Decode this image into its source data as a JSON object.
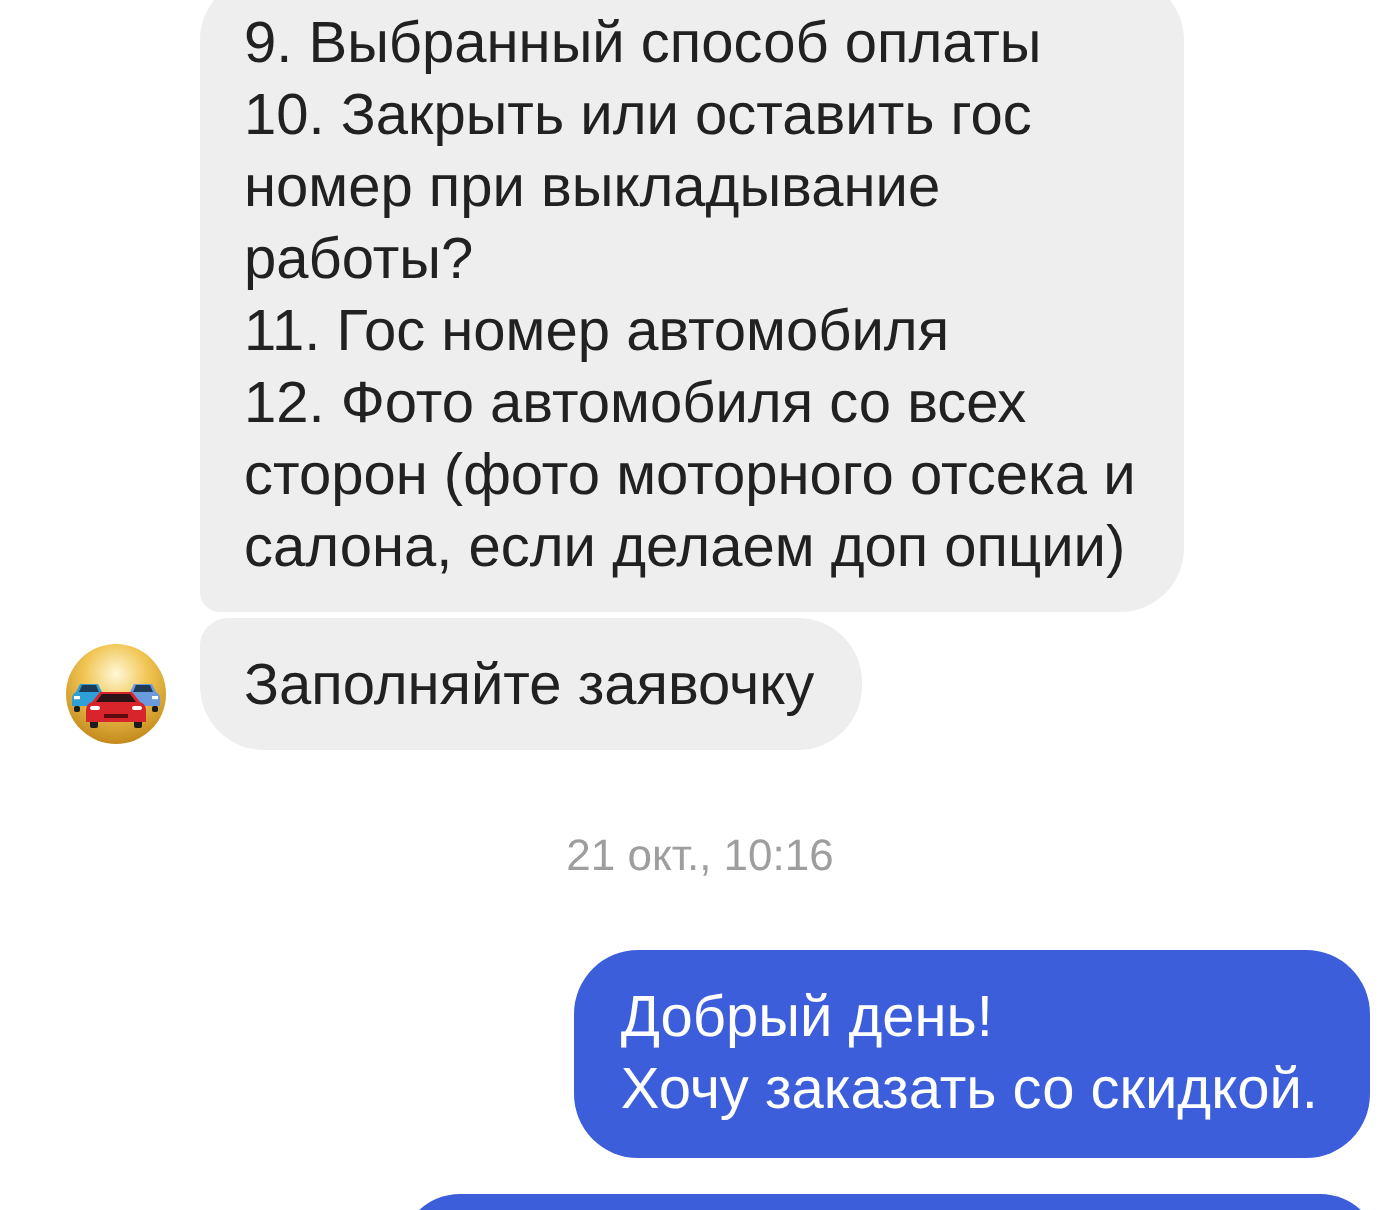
{
  "messages": [
    {
      "kind": "incoming",
      "avatar": false,
      "text": "9. Выбранный способ оплаты\n10. Закрыть или оставить гос\nномер при выкладывание\nработы?\n11. Гос номер автомобиля\n12. Фото автомобиля со всех\nсторон (фото моторного отсека и\nсалона, если делаем доп опции)"
    },
    {
      "kind": "incoming",
      "avatar": true,
      "text": "Заполняйте заявочку"
    },
    {
      "kind": "date",
      "text": "21 окт., 10:16"
    },
    {
      "kind": "outgoing",
      "text": "Добрый день!\nХочу заказать со скидкой."
    },
    {
      "kind": "outgoing"
    }
  ]
}
